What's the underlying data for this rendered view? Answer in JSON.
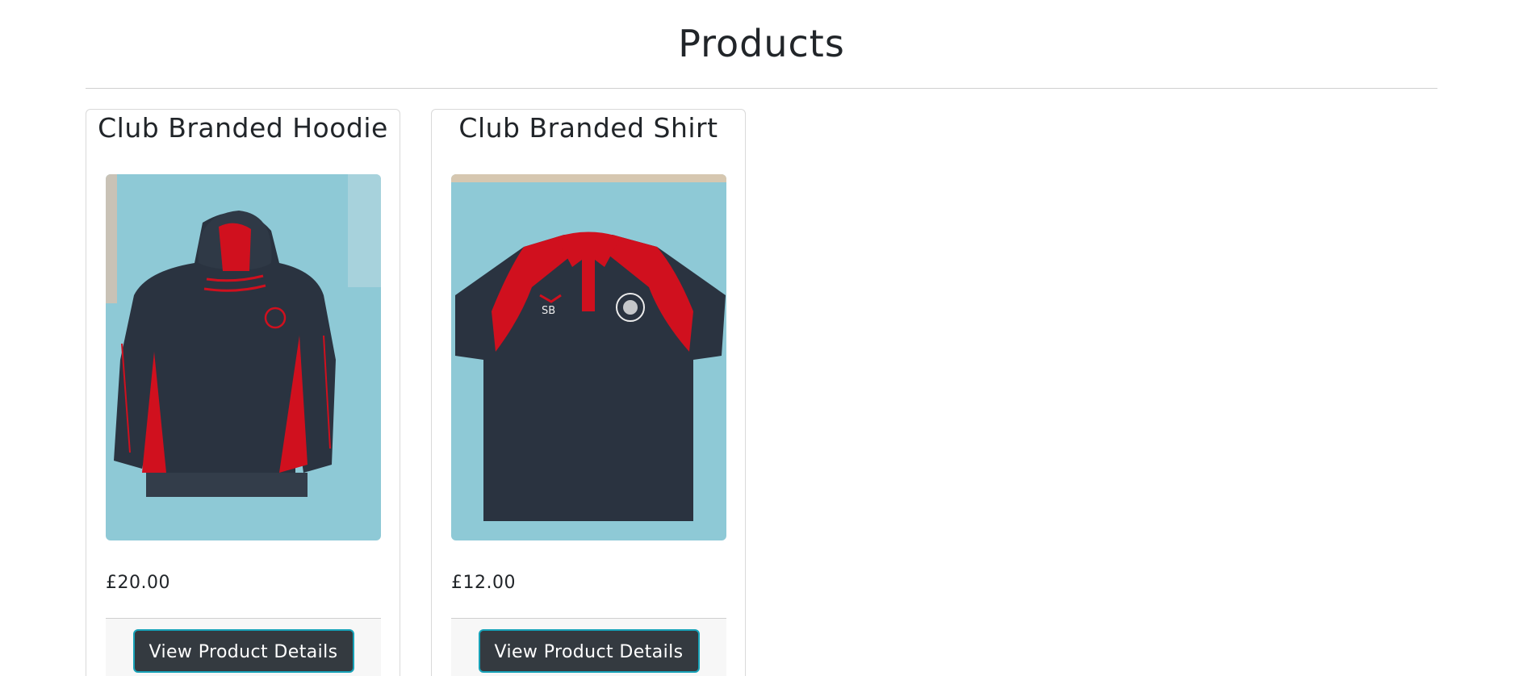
{
  "page": {
    "title": "Products"
  },
  "products": [
    {
      "name": "Club Branded Hoodie",
      "price": "£20.00",
      "button_label": "View Product Details",
      "image_alt": "Club Branded Hoodie"
    },
    {
      "name": "Club Branded Shirt",
      "price": "£12.00",
      "button_label": "View Product Details",
      "image_alt": "Club Branded Shirt"
    }
  ],
  "colors": {
    "button_bg": "#343a40",
    "button_border": "#17a2b8",
    "garment_navy": "#2a3340",
    "garment_red": "#d0101e",
    "backdrop_blue": "#8ec9d6"
  }
}
